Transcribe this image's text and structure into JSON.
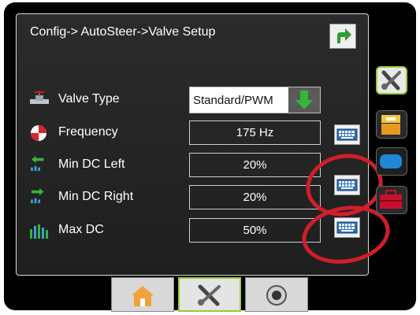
{
  "header": {
    "title": "Config-> AutoSteer->Valve Setup"
  },
  "icons": {
    "back": "return-arrow-icon",
    "valve": "valve-icon",
    "frequency": "frequency-icon",
    "min_left": "min-dc-left-icon",
    "min_right": "min-dc-right-icon",
    "max": "max-dc-icon",
    "keyboard": "keyboard-icon"
  },
  "rows": [
    {
      "label": "Valve Type",
      "value": "Standard/PWM"
    },
    {
      "label": "Frequency",
      "value": "175 Hz"
    },
    {
      "label": "Min DC Left",
      "value": "20%"
    },
    {
      "label": "Min DC Right",
      "value": "20%"
    },
    {
      "label": "Max DC",
      "value": "50%"
    }
  ],
  "side_tabs": [
    {
      "name": "tools",
      "active": true
    },
    {
      "name": "console",
      "active": false
    },
    {
      "name": "display",
      "active": false
    },
    {
      "name": "toolbox",
      "active": false
    }
  ],
  "bottom_tabs": [
    {
      "name": "home",
      "active": false
    },
    {
      "name": "config",
      "active": true
    },
    {
      "name": "camera",
      "active": false
    }
  ],
  "colors": {
    "accent": "#9acd32",
    "annotation": "#d11e2a",
    "arrow_green": "#2e9e2e"
  }
}
